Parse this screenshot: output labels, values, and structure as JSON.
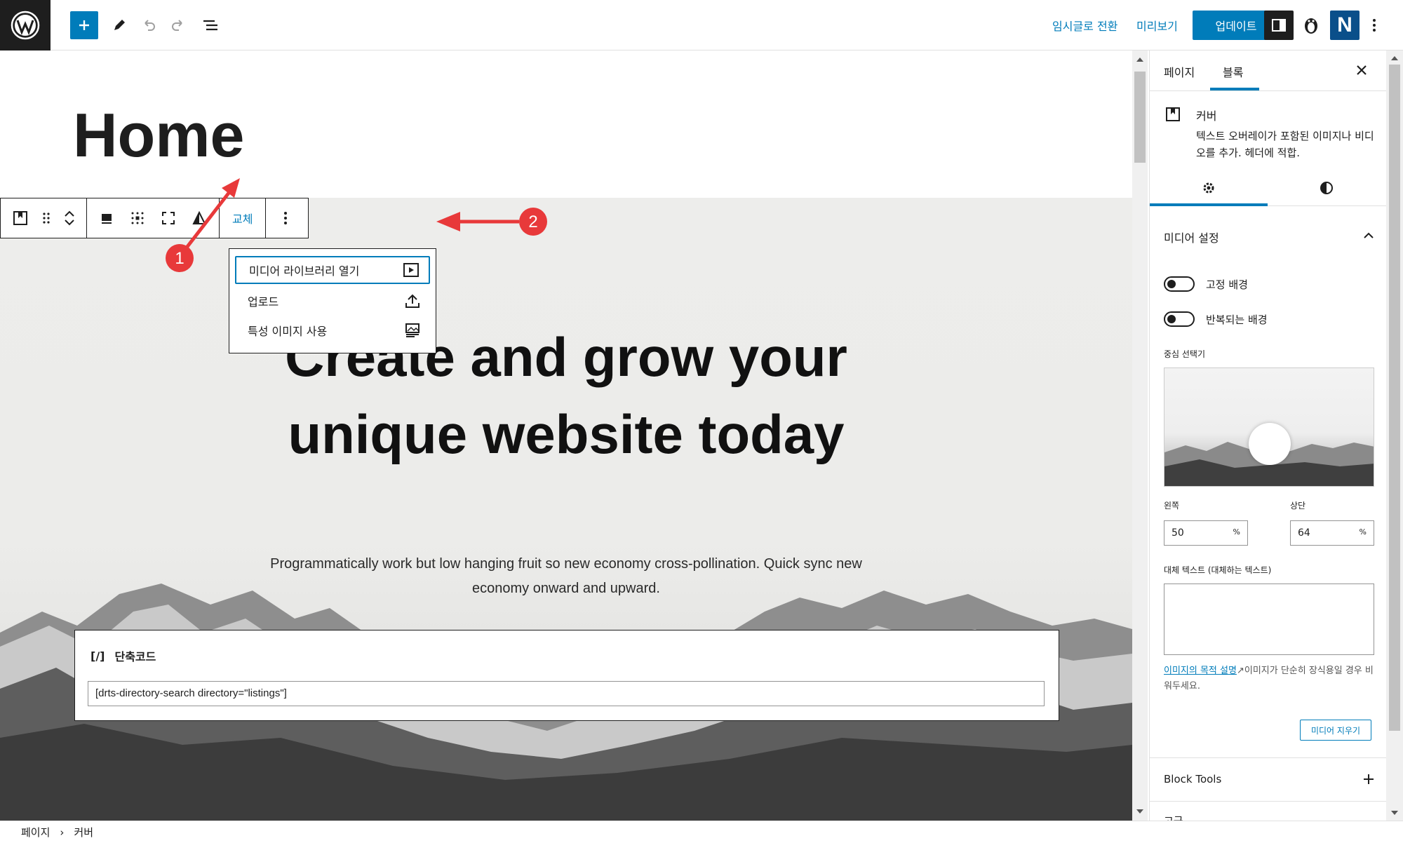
{
  "topbar": {
    "draft_label": "임시글로 전환",
    "preview_label": "미리보기",
    "update_label": "업데이트",
    "plugin_letter": "N"
  },
  "canvas": {
    "page_title": "Home",
    "hero_title_line1": "Create and grow your",
    "hero_title_line2": "unique website today",
    "hero_sub": "Programmatically work but low hanging fruit so new economy cross-pollination. Quick sync new economy onward and upward.",
    "shortcode_label": "단축코드",
    "shortcode_icon": "[/]",
    "shortcode_value": "[drts-directory-search directory=\"listings\"]"
  },
  "toolbar": {
    "replace_label": "교체"
  },
  "dropdown": {
    "items": [
      {
        "label": "미디어 라이브러리 열기",
        "icon": "media-icon"
      },
      {
        "label": "업로드",
        "icon": "upload-icon"
      },
      {
        "label": "특성 이미지 사용",
        "icon": "featured-image-icon"
      }
    ]
  },
  "annotations": {
    "marker1": "1",
    "marker2": "2",
    "color": "#e8393a"
  },
  "sidebar": {
    "tab_page": "페이지",
    "tab_block": "블록",
    "block_name": "커버",
    "block_desc": "텍스트 오버레이가 포함된 이미지나 비디오를 추가. 헤더에 적합.",
    "panel_title": "미디어 설정",
    "toggle_fixed": "고정 배경",
    "toggle_repeat": "반복되는 배경",
    "focal_label": "중심 선택기",
    "left_label": "왼쪽",
    "top_label": "상단",
    "left_value": "50",
    "top_value": "64",
    "percent": "%",
    "alt_label": "대체 텍스트 (대체하는 텍스트)",
    "alt_link": "이미지의 목적 설명",
    "alt_help": "이미지가 단순히 장식용일 경우 비워두세요.",
    "clear_media": "미디어 지우기",
    "block_tools": "Block Tools",
    "next_panel": "고급"
  },
  "footer": {
    "crumb1": "페이지",
    "separator": "›",
    "crumb2": "커버"
  },
  "colors": {
    "accent": "#007cba",
    "dark": "#1e1e1e"
  }
}
